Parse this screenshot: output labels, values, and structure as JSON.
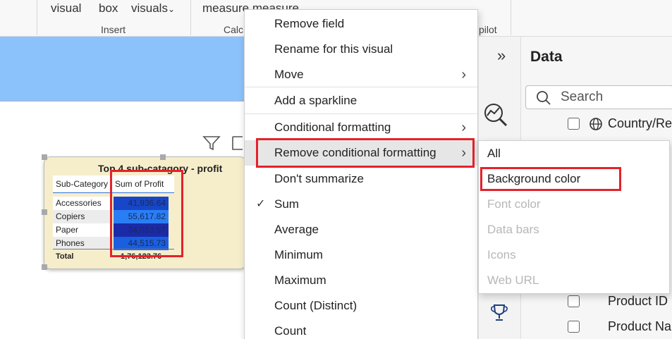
{
  "ribbon": {
    "items": [
      "visual",
      "box",
      "visuals",
      "measure measure"
    ],
    "groups": [
      "Insert",
      "Calc",
      "pilot"
    ]
  },
  "visual": {
    "title": "Top 4 sub-catagory - profit",
    "columns": [
      "Sub-Category",
      "Sum of Profit"
    ],
    "rows": [
      {
        "category": "Accessories",
        "profit": "41,936.64",
        "color": "#1746c9"
      },
      {
        "category": "Copiers",
        "profit": "55,617.82",
        "color": "#2a7ef5"
      },
      {
        "category": "Paper",
        "profit": "34,053.57",
        "color": "#1b2aa8"
      },
      {
        "category": "Phones",
        "profit": "44,515.73",
        "color": "#1a5fe0"
      }
    ],
    "total_label": "Total",
    "total_value": "1,76,123.76"
  },
  "context_menu": {
    "items": [
      {
        "label": "Remove field"
      },
      {
        "label": "Rename for this visual"
      },
      {
        "label": "Move",
        "submenu": true
      },
      {
        "label": "Add a sparkline"
      },
      {
        "label": "Conditional formatting",
        "submenu": true
      },
      {
        "label": "Remove conditional formatting",
        "submenu": true,
        "highlighted": true
      },
      {
        "label": "Don't summarize"
      },
      {
        "label": "Sum",
        "checked": true
      },
      {
        "label": "Average"
      },
      {
        "label": "Minimum"
      },
      {
        "label": "Maximum"
      },
      {
        "label": "Count (Distinct)"
      },
      {
        "label": "Count"
      }
    ]
  },
  "submenu": {
    "items": [
      {
        "label": "All",
        "enabled": true
      },
      {
        "label": "Background color",
        "enabled": true,
        "highlighted": true
      },
      {
        "label": "Font color",
        "enabled": false
      },
      {
        "label": "Data bars",
        "enabled": false
      },
      {
        "label": "Icons",
        "enabled": false
      },
      {
        "label": "Web URL",
        "enabled": false
      }
    ]
  },
  "data_pane": {
    "title": "Data",
    "search_placeholder": "Search",
    "fields": [
      "Country/Re",
      "Product ID",
      "Product Na"
    ]
  },
  "colors": {
    "highlight_border": "#e3222b",
    "blue_band": "#8cc2fc",
    "visual_bg": "#f6eecb"
  }
}
